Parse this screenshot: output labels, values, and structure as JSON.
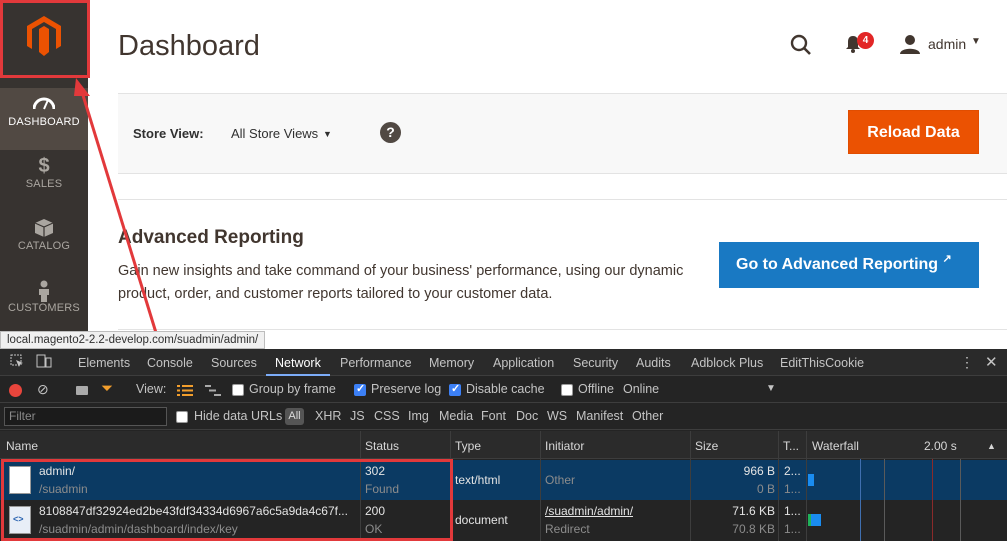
{
  "sidebar": {
    "items": [
      {
        "label": "DASHBOARD",
        "icon": "speedometer-icon",
        "active": true
      },
      {
        "label": "SALES",
        "icon": "dollar-icon",
        "active": false
      },
      {
        "label": "CATALOG",
        "icon": "box-icon",
        "active": false
      },
      {
        "label": "CUSTOMERS",
        "icon": "person-icon",
        "active": false
      }
    ]
  },
  "header": {
    "title": "Dashboard",
    "notification_count": "4",
    "user": "admin"
  },
  "store_bar": {
    "label": "Store View:",
    "value": "All Store Views",
    "reload_label": "Reload Data"
  },
  "advanced": {
    "title": "Advanced Reporting",
    "text": "Gain new insights and take command of your business' performance, using our dynamic product, order, and customer reports tailored to your customer data.",
    "button_label": "Go to Advanced Reporting"
  },
  "status_url": "local.magento2-2.2-develop.com/suadmin/admin/",
  "devtools": {
    "tabs": [
      "Elements",
      "Console",
      "Sources",
      "Network",
      "Performance",
      "Memory",
      "Application",
      "Security",
      "Audits",
      "Adblock Plus",
      "EditThisCookie"
    ],
    "active_tab": "Network",
    "toolbar": {
      "view_label": "View:",
      "group_by_frame": "Group by frame",
      "preserve_log": "Preserve log",
      "disable_cache": "Disable cache",
      "offline": "Offline",
      "throttle": "Online"
    },
    "filter": {
      "placeholder": "Filter",
      "hide_data_urls": "Hide data URLs",
      "all": "All",
      "types": [
        "XHR",
        "JS",
        "CSS",
        "Img",
        "Media",
        "Font",
        "Doc",
        "WS",
        "Manifest",
        "Other"
      ]
    },
    "columns": [
      "Name",
      "Status",
      "Type",
      "Initiator",
      "Size",
      "T...",
      "Waterfall"
    ],
    "waterfall_time": "2.00 s",
    "rows": [
      {
        "name": "admin/",
        "path": "/suadmin",
        "status": "302",
        "status_text": "Found",
        "type": "text/html",
        "initiator": "Other",
        "initiator_sub": "",
        "size": "966 B",
        "size_sub": "0 B",
        "time": "2...",
        "time_sub": "1..."
      },
      {
        "name": "8108847df32924ed2be43fdf34334d6967a6c5a9da4c67f...",
        "path": "/suadmin/admin/dashboard/index/key",
        "status": "200",
        "status_text": "OK",
        "type": "document",
        "initiator": "/suadmin/admin/",
        "initiator_sub": "Redirect",
        "size": "71.6 KB",
        "size_sub": "70.8 KB",
        "time": "1...",
        "time_sub": "1..."
      }
    ]
  },
  "colors": {
    "magento_orange": "#eb5202",
    "magento_blue": "#1979c3",
    "sidebar_bg": "#373330",
    "annotation_red": "#e2393b"
  }
}
